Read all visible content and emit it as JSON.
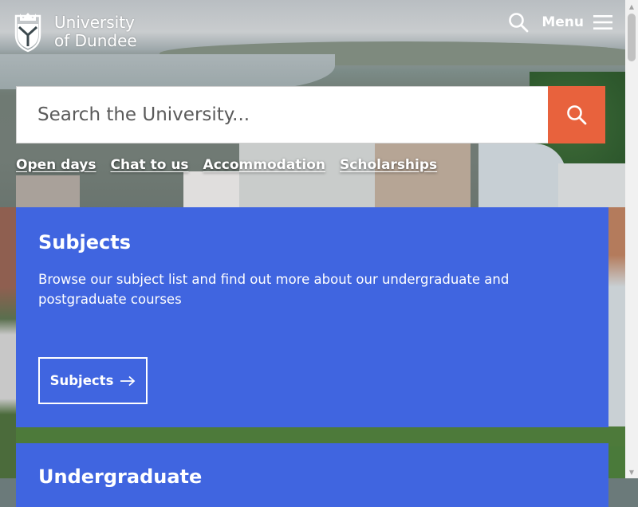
{
  "header": {
    "logo_line1": "University",
    "logo_line2": "of Dundee",
    "menu_label": "Menu"
  },
  "search": {
    "placeholder": "Search the University..."
  },
  "quick_links": [
    {
      "label": "Open days"
    },
    {
      "label": "Chat to us"
    },
    {
      "label": "Accommodation"
    },
    {
      "label": "Scholarships"
    }
  ],
  "cards": {
    "subjects": {
      "title": "Subjects",
      "description": "Browse our subject list and find out more about our undergraduate and postgraduate courses",
      "button_label": "Subjects"
    },
    "undergraduate": {
      "title": "Undergraduate"
    }
  },
  "colors": {
    "card_blue": "#4065e0",
    "search_orange": "#e8623d"
  },
  "icons": {
    "search": "search-icon",
    "menu": "hamburger-icon",
    "arrow": "arrow-right-icon",
    "crest": "university-crest-icon"
  }
}
